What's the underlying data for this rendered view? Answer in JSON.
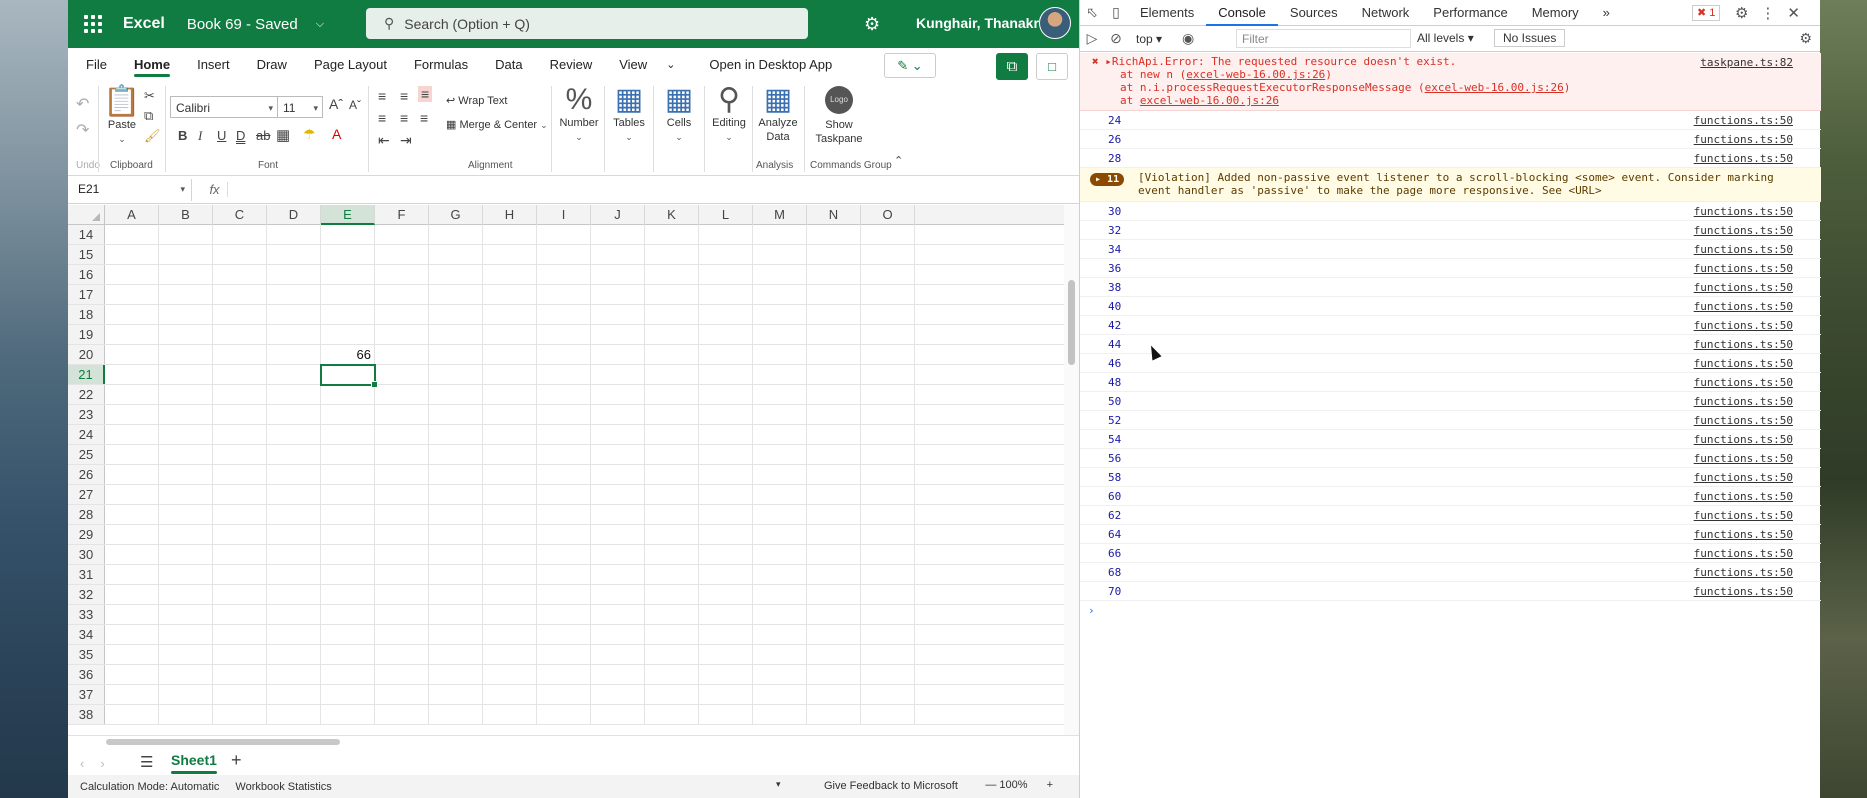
{
  "excel": {
    "app_name": "Excel",
    "doc_name": "Book 69 - Saved",
    "search_placeholder": "Search (Option + Q)",
    "user_name": "Kunghair, Thanakri...",
    "menu_tabs": [
      "File",
      "Home",
      "Insert",
      "Draw",
      "Page Layout",
      "Formulas",
      "Data",
      "Review",
      "View"
    ],
    "open_desktop": "Open in Desktop App",
    "ribbon": {
      "undo_label": "Undo",
      "paste_label": "Paste",
      "clipboard_label": "Clipboard",
      "font_name": "Calibri",
      "font_size": "11",
      "font_label": "Font",
      "wrap_text": "Wrap Text",
      "merge_center": "Merge & Center",
      "alignment_label": "Alignment",
      "number_label": "Number",
      "tables_label": "Tables",
      "cells_label": "Cells",
      "editing_label": "Editing",
      "analyze_label": "Analyze Data",
      "analysis_label": "Analysis",
      "show_taskpane": "Show Taskpane",
      "logo_text": "Logo",
      "commands_group": "Commands Group"
    },
    "name_box": "E21",
    "fx": "fx",
    "columns": [
      "A",
      "B",
      "C",
      "D",
      "E",
      "F",
      "G",
      "H",
      "I",
      "J",
      "K",
      "L",
      "M",
      "N",
      "O"
    ],
    "rows": [
      "14",
      "15",
      "16",
      "17",
      "18",
      "19",
      "20",
      "21",
      "22",
      "23",
      "24",
      "25",
      "26",
      "27",
      "28",
      "29",
      "30",
      "31",
      "32",
      "33",
      "34",
      "35",
      "36",
      "37",
      "38"
    ],
    "selected_column": "E",
    "selected_row": "21",
    "cell_e20": "66",
    "sheet_name": "Sheet1",
    "status": {
      "calc_mode": "Calculation Mode: Automatic",
      "workbook_stats": "Workbook Statistics",
      "feedback": "Give Feedback to Microsoft",
      "zoom": "100%"
    }
  },
  "devtools": {
    "tabs": [
      "Elements",
      "Console",
      "Sources",
      "Network",
      "Performance",
      "Memory"
    ],
    "active_tab": "Console",
    "error_count": "1",
    "context": "top",
    "filter_placeholder": "Filter",
    "levels": "All levels",
    "issues": "No Issues",
    "error": {
      "line1": "RichApi.Error: The requested resource doesn't exist.",
      "line2_pre": "at new n (",
      "line2_link": "excel-web-16.00.js:26",
      "line3_pre": "at n.i.processRequestExecutorResponseMessage (",
      "line3_link": "excel-web-16.00.js:26",
      "line4_pre": "at ",
      "line4_link": "excel-web-16.00.js:26",
      "source": "taskpane.ts:82"
    },
    "logs_before": [
      "24",
      "26",
      "28"
    ],
    "warning": {
      "count": "11",
      "text1": "[Violation] Added non-passive event listener to a scroll-blocking <some> event. Consider marking",
      "text2": "event handler as 'passive' to make the page more responsive. See <URL>"
    },
    "logs_after": [
      "30",
      "32",
      "34",
      "36",
      "38",
      "40",
      "42",
      "44",
      "46",
      "48",
      "50",
      "52",
      "54",
      "56",
      "58",
      "60",
      "62",
      "64",
      "66",
      "68",
      "70"
    ],
    "log_source": "functions.ts:50"
  }
}
